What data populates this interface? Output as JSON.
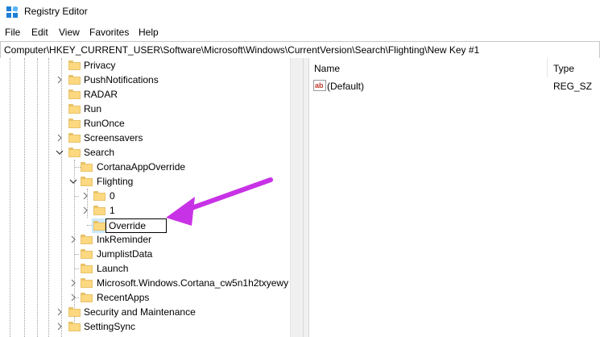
{
  "window": {
    "title": "Registry Editor",
    "icon": "registry-editor-icon"
  },
  "menu": [
    "File",
    "Edit",
    "View",
    "Favorites",
    "Help"
  ],
  "address": "Computer\\HKEY_CURRENT_USER\\Software\\Microsoft\\Windows\\CurrentVersion\\Search\\Flighting\\New Key #1",
  "tree": {
    "privacy": "Privacy",
    "pushnotifications": "PushNotifications",
    "radar": "RADAR",
    "run": "Run",
    "runonce": "RunOnce",
    "screensavers": "Screensavers",
    "search": "Search",
    "cortanaappoverride": "CortanaAppOverride",
    "flighting": "Flighting",
    "flighting_0": "0",
    "flighting_1": "1",
    "rename_value": "Override",
    "inkreminder": "InkReminder",
    "jumplistdata": "JumplistData",
    "launch": "Launch",
    "cortana_package": "Microsoft.Windows.Cortana_cw5n1h2txyewy",
    "recentapps": "RecentApps",
    "security": "Security and Maintenance",
    "settingsync": "SettingSync"
  },
  "values_pane": {
    "headers": {
      "name": "Name",
      "type": "Type"
    },
    "rows": [
      {
        "name": "(Default)",
        "type": "REG_SZ",
        "icon": "string-value-icon"
      }
    ]
  },
  "colors": {
    "arrow": "#c832e6",
    "folder": "#fcd981",
    "selection": "#cce8ff"
  }
}
